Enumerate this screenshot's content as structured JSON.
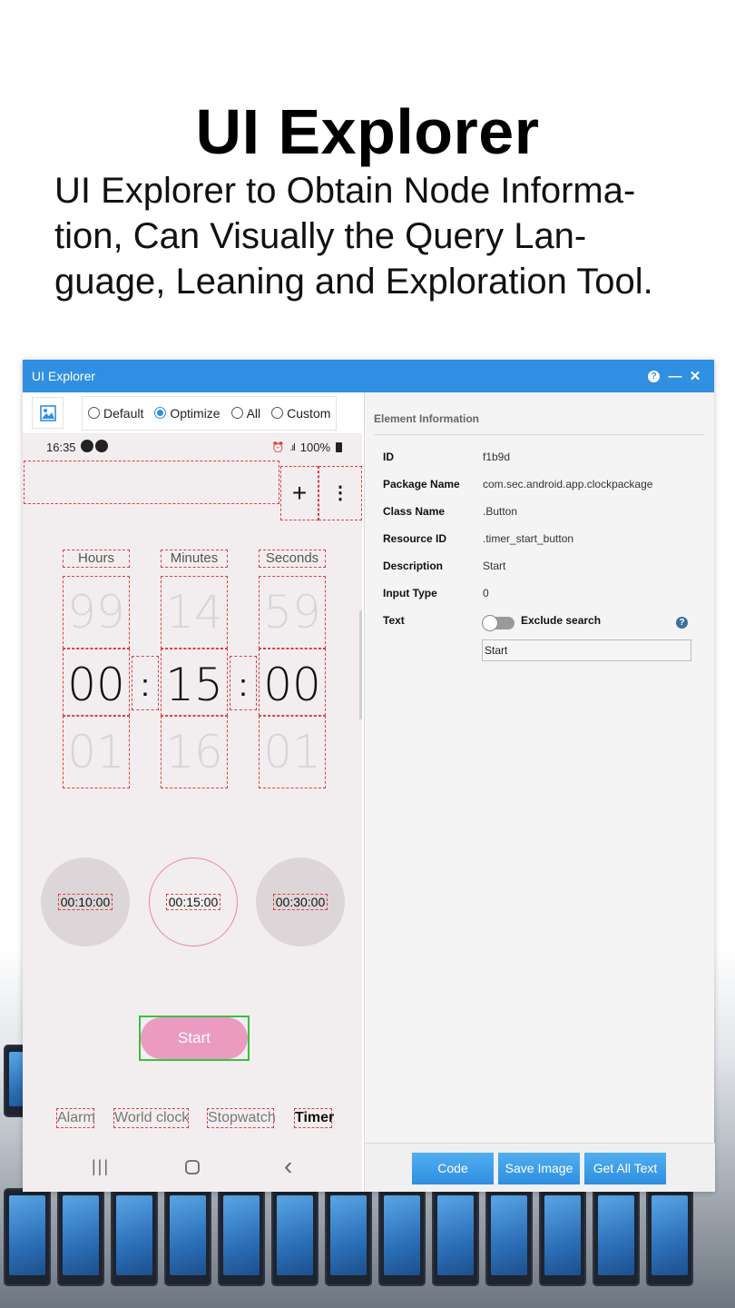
{
  "hero": {
    "title": "UI Explorer",
    "subtitle_lines": [
      "UI Explorer to Obtain Node Informa-",
      "tion, Can Visually the Query Lan-",
      "guage, Leaning and Exploration Tool."
    ]
  },
  "window": {
    "title": "UI Explorer",
    "help_icon": "help-icon",
    "minimize_icon": "minimize-icon",
    "close_icon": "close-icon",
    "minimize_glyph": "—",
    "close_glyph": "✕",
    "help_glyph": "?"
  },
  "toolbar": {
    "screenshot_icon": "image-icon",
    "modes": [
      {
        "label": "Default",
        "selected": false
      },
      {
        "label": "Optimize",
        "selected": true
      },
      {
        "label": "All",
        "selected": false
      },
      {
        "label": "Custom",
        "selected": false
      }
    ]
  },
  "phone": {
    "status": {
      "time": "16:35",
      "battery": "100%"
    },
    "actions": {
      "add_glyph": "+",
      "more_glyph": "⋮"
    },
    "columns": [
      {
        "label": "Hours",
        "prev": "99",
        "value": "00",
        "next": "01"
      },
      {
        "label": "Minutes",
        "prev": "14",
        "value": "15",
        "next": "16"
      },
      {
        "label": "Seconds",
        "prev": "59",
        "value": "00",
        "next": "01"
      }
    ],
    "colon": ":",
    "presets": [
      "00:10:00",
      "00:15:00",
      "00:30:00"
    ],
    "start_label": "Start",
    "tabs": [
      "Alarm",
      "World clock",
      "Stopwatch",
      "Timer"
    ],
    "active_tab": "Timer",
    "nav": {
      "recent": "|||",
      "home": "○",
      "back": "‹"
    }
  },
  "element_info": {
    "heading": "Element Information",
    "rows": [
      {
        "key": "ID",
        "value": "f1b9d"
      },
      {
        "key": "Package Name",
        "value": "com.sec.android.app.clockpackage"
      },
      {
        "key": "Class Name",
        "value": ".Button"
      },
      {
        "key": "Resource ID",
        "value": ".timer_start_button"
      },
      {
        "key": "Description",
        "value": "Start"
      },
      {
        "key": "Input Type",
        "value": "0"
      }
    ],
    "text_key": "Text",
    "exclude_label": "Exclude search",
    "exclude_on": false,
    "help_glyph": "?",
    "text_value": "Start"
  },
  "actions": {
    "code": "Code",
    "save_image": "Save Image",
    "get_all_text": "Get All Text"
  },
  "colors": {
    "accent": "#2f8fe0",
    "start_button": "#eb9bc2",
    "selection_outline": "#38c23a",
    "node_dash": "#e03c3c"
  }
}
